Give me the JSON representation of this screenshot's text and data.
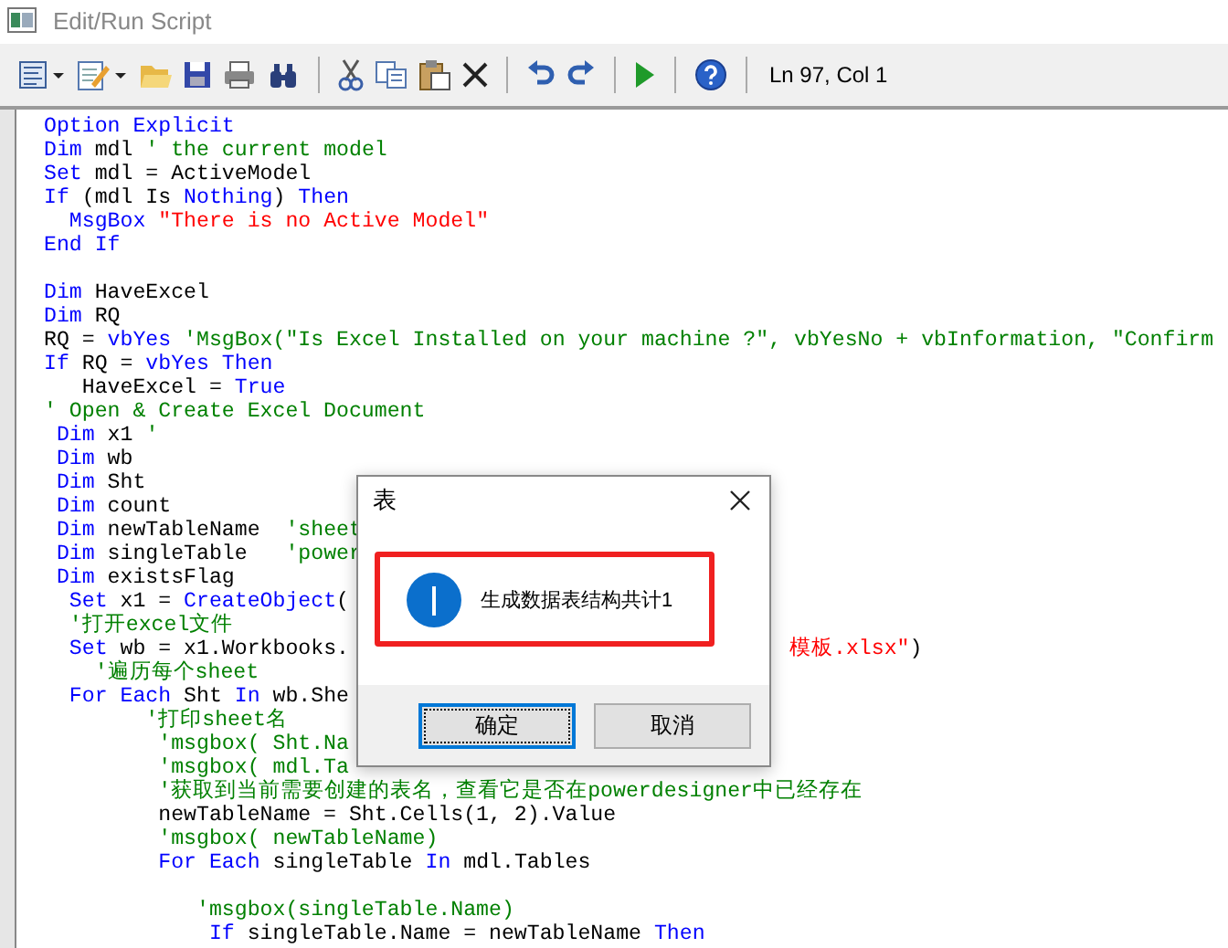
{
  "window": {
    "title": "Edit/Run Script"
  },
  "toolbar": {
    "status": "Ln 97, Col 1"
  },
  "editor": {
    "lines": [
      {
        "kind": "code",
        "segments": [
          {
            "kind": "kw",
            "text": "Option Explicit"
          }
        ]
      },
      {
        "kind": "code",
        "segments": [
          {
            "kind": "kw",
            "text": "Dim"
          },
          {
            "kind": "plain",
            "text": " mdl "
          },
          {
            "kind": "comment",
            "text": "' the current model"
          }
        ]
      },
      {
        "kind": "code",
        "segments": [
          {
            "kind": "kw",
            "text": "Set"
          },
          {
            "kind": "plain",
            "text": " mdl = ActiveModel"
          }
        ]
      },
      {
        "kind": "code",
        "segments": [
          {
            "kind": "kw",
            "text": "If"
          },
          {
            "kind": "plain",
            "text": " (mdl Is "
          },
          {
            "kind": "kw",
            "text": "Nothing"
          },
          {
            "kind": "plain",
            "text": ") "
          },
          {
            "kind": "kw",
            "text": "Then"
          }
        ]
      },
      {
        "kind": "code",
        "segments": [
          {
            "kind": "kw",
            "text": "  MsgBox"
          },
          {
            "kind": "string",
            "text": " \"There is no Active Model\""
          }
        ]
      },
      {
        "kind": "code",
        "segments": [
          {
            "kind": "kw",
            "text": "End If"
          }
        ]
      },
      {
        "kind": "blank"
      },
      {
        "kind": "code",
        "segments": [
          {
            "kind": "kw",
            "text": "Dim"
          },
          {
            "kind": "plain",
            "text": " HaveExcel"
          }
        ]
      },
      {
        "kind": "code",
        "segments": [
          {
            "kind": "kw",
            "text": "Dim"
          },
          {
            "kind": "plain",
            "text": " RQ"
          }
        ]
      },
      {
        "kind": "code",
        "segments": [
          {
            "kind": "plain",
            "text": "RQ = "
          },
          {
            "kind": "kw",
            "text": "vbYes"
          },
          {
            "kind": "comment",
            "text": " 'MsgBox(\"Is Excel Installed on your machine ?\", vbYesNo + vbInformation, \"Confirm"
          }
        ]
      },
      {
        "kind": "code",
        "segments": [
          {
            "kind": "kw",
            "text": "If"
          },
          {
            "kind": "plain",
            "text": " RQ = "
          },
          {
            "kind": "kw",
            "text": "vbYes Then"
          }
        ]
      },
      {
        "kind": "code",
        "segments": [
          {
            "kind": "plain",
            "text": "   HaveExcel = "
          },
          {
            "kind": "kw",
            "text": "True"
          }
        ]
      },
      {
        "kind": "code",
        "segments": [
          {
            "kind": "comment",
            "text": "' Open & Create Excel Document"
          }
        ]
      },
      {
        "kind": "code",
        "segments": [
          {
            "kind": "kw",
            "text": " Dim"
          },
          {
            "kind": "plain",
            "text": " x1 "
          },
          {
            "kind": "comment",
            "text": "'"
          }
        ]
      },
      {
        "kind": "code",
        "segments": [
          {
            "kind": "kw",
            "text": " Dim"
          },
          {
            "kind": "plain",
            "text": " wb"
          }
        ]
      },
      {
        "kind": "code",
        "segments": [
          {
            "kind": "kw",
            "text": " Dim"
          },
          {
            "kind": "plain",
            "text": " Sht"
          }
        ]
      },
      {
        "kind": "code",
        "segments": [
          {
            "kind": "kw",
            "text": " Dim"
          },
          {
            "kind": "plain",
            "text": " count"
          }
        ]
      },
      {
        "kind": "code",
        "segments": [
          {
            "kind": "kw",
            "text": " Dim"
          },
          {
            "kind": "plain",
            "text": " newTableName  "
          },
          {
            "kind": "comment",
            "text": "'sheet"
          }
        ]
      },
      {
        "kind": "code",
        "segments": [
          {
            "kind": "kw",
            "text": " Dim"
          },
          {
            "kind": "plain",
            "text": " singleTable   "
          },
          {
            "kind": "comment",
            "text": "'power"
          }
        ]
      },
      {
        "kind": "code",
        "segments": [
          {
            "kind": "kw",
            "text": " Dim"
          },
          {
            "kind": "plain",
            "text": " existsFlag"
          }
        ]
      },
      {
        "kind": "code",
        "segments": [
          {
            "kind": "kw",
            "text": "  Set"
          },
          {
            "kind": "plain",
            "text": " x1 = "
          },
          {
            "kind": "kw",
            "text": "CreateObject"
          },
          {
            "kind": "plain",
            "text": "("
          }
        ]
      },
      {
        "kind": "code",
        "segments": [
          {
            "kind": "comment",
            "text": "  '打开excel文件"
          }
        ]
      },
      {
        "kind": "code",
        "segments": [
          {
            "kind": "kw",
            "text": "  Set"
          },
          {
            "kind": "plain",
            "text": " wb = x1.Workbooks."
          }
        ],
        "right": [
          {
            "kind": "string",
            "text": "模板.xlsx\""
          },
          {
            "kind": "plain",
            "text": ")"
          }
        ]
      },
      {
        "kind": "code",
        "segments": [
          {
            "kind": "comment",
            "text": "    '遍历每个sheet"
          }
        ]
      },
      {
        "kind": "code",
        "segments": [
          {
            "kind": "kw",
            "text": "  For Each"
          },
          {
            "kind": "plain",
            "text": " Sht "
          },
          {
            "kind": "kw",
            "text": "In"
          },
          {
            "kind": "plain",
            "text": " wb.She"
          }
        ]
      },
      {
        "kind": "code",
        "segments": [
          {
            "kind": "comment",
            "text": "        '打印sheet名"
          }
        ]
      },
      {
        "kind": "code",
        "segments": [
          {
            "kind": "comment",
            "text": "         'msgbox( Sht.Na"
          }
        ]
      },
      {
        "kind": "code",
        "segments": [
          {
            "kind": "comment",
            "text": "         'msgbox( mdl.Ta"
          }
        ]
      },
      {
        "kind": "code",
        "segments": [
          {
            "kind": "comment",
            "text": "         '获取到当前需要创建的表名，查看它是否在powerdesigner中已经存在"
          }
        ]
      },
      {
        "kind": "code",
        "segments": [
          {
            "kind": "plain",
            "text": "         newTableName = Sht.Cells(1, 2).Value"
          }
        ]
      },
      {
        "kind": "code",
        "segments": [
          {
            "kind": "comment",
            "text": "         'msgbox( newTableName)"
          }
        ]
      },
      {
        "kind": "code",
        "segments": [
          {
            "kind": "kw",
            "text": "         For Each"
          },
          {
            "kind": "plain",
            "text": " singleTable "
          },
          {
            "kind": "kw",
            "text": "In"
          },
          {
            "kind": "plain",
            "text": " mdl.Tables"
          }
        ]
      },
      {
        "kind": "blank"
      },
      {
        "kind": "code",
        "segments": [
          {
            "kind": "comment",
            "text": "            'msgbox(singleTable.Name)"
          }
        ]
      },
      {
        "kind": "code",
        "segments": [
          {
            "kind": "kw",
            "text": "             If"
          },
          {
            "kind": "plain",
            "text": " singleTable.Name = newTableName "
          },
          {
            "kind": "kw",
            "text": "Then"
          }
        ]
      }
    ]
  },
  "dialog": {
    "title": "表",
    "message": "生成数据表结构共计1",
    "buttons": [
      {
        "label": "确定",
        "selected": true
      },
      {
        "label": "取消",
        "selected": false
      }
    ]
  }
}
